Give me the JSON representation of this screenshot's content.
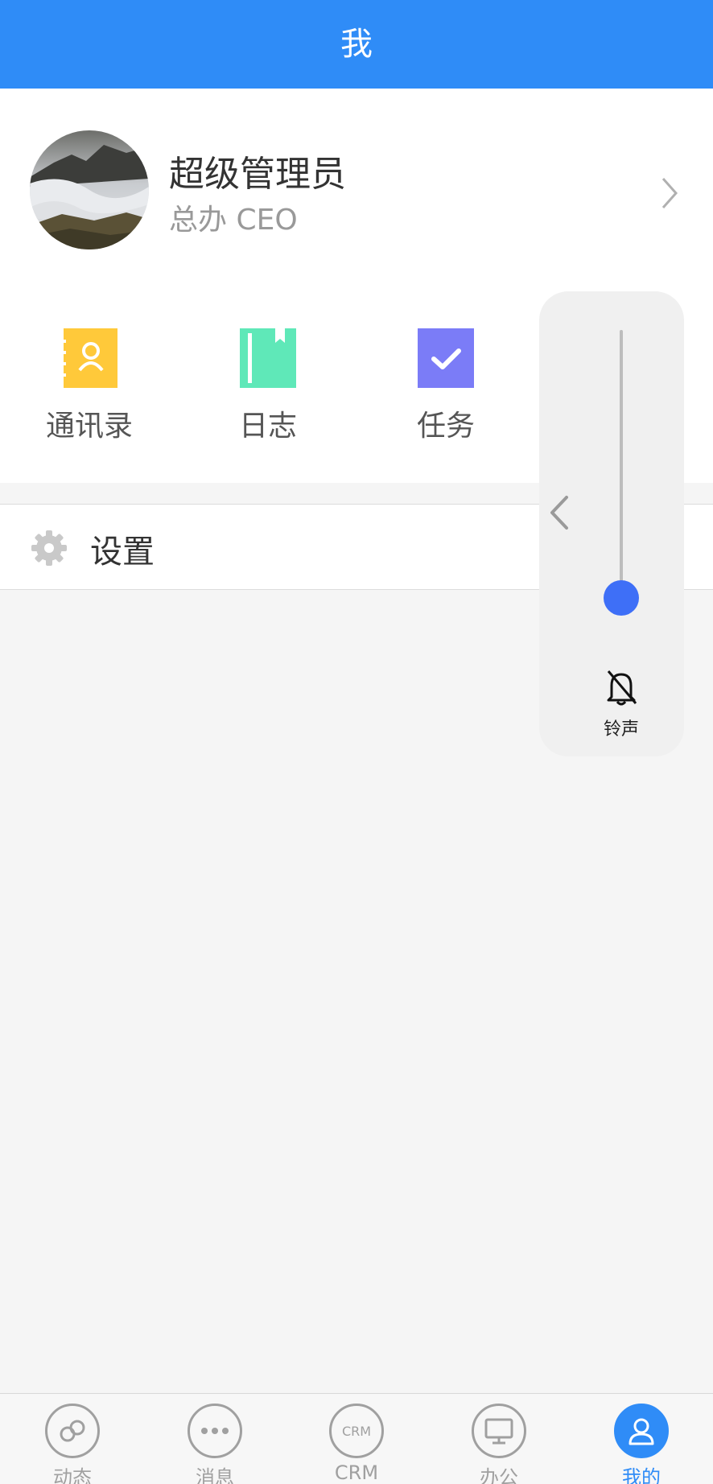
{
  "header": {
    "title": "我"
  },
  "profile": {
    "name": "超级管理员",
    "subtitle": "总办 CEO"
  },
  "quick_actions": [
    {
      "label": "通讯录",
      "icon": "contacts-icon",
      "color": "#ffc93a"
    },
    {
      "label": "日志",
      "icon": "journal-icon",
      "color": "#5fe8b8"
    },
    {
      "label": "任务",
      "icon": "task-icon",
      "color": "#7b7cf7"
    }
  ],
  "settings": {
    "label": "设置",
    "icon": "gear-icon"
  },
  "volume_panel": {
    "label": "铃声",
    "level": 0.05,
    "icon": "bell-muted-icon",
    "knob_color": "#3e6ff7"
  },
  "tabbar": {
    "active_color": "#2f8cf7",
    "items": [
      {
        "label": "动态",
        "icon": "feed-icon"
      },
      {
        "label": "消息",
        "icon": "message-icon"
      },
      {
        "label": "CRM",
        "icon": "crm-icon",
        "icon_text": "CRM"
      },
      {
        "label": "办公",
        "icon": "office-icon"
      },
      {
        "label": "我的",
        "icon": "user-icon"
      }
    ]
  }
}
